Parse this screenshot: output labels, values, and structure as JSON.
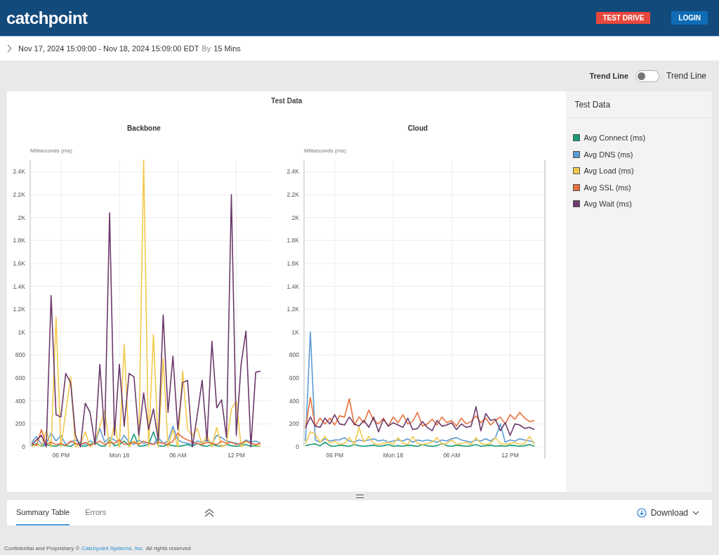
{
  "header": {
    "logo": "catchpoint",
    "buttons": [
      {
        "label": "TEST DRIVE",
        "kind": "trial"
      },
      {
        "label": "LOGIN",
        "kind": "login"
      }
    ]
  },
  "date_range": {
    "range": "Nov 17, 2024 15:09:00 - Nov 18, 2024 15:09:00 EDT",
    "by": "By",
    "interval": "15 Mins"
  },
  "trend_line": {
    "label": "Trend Line",
    "toggle_label": "Trend Line",
    "on": false
  },
  "panel": {
    "title": "Test Data",
    "charts": [
      {
        "chart_data": {
          "type": "line",
          "title": "Backbone",
          "ylabel": "Miliseconds (ms)",
          "categories": [
            null,
            null,
            null,
            null,
            null,
            null,
            "06 PM",
            null,
            null,
            null,
            null,
            null,
            null,
            null,
            null,
            null,
            null,
            null,
            "Mon 18",
            null,
            null,
            null,
            null,
            null,
            null,
            null,
            null,
            null,
            null,
            null,
            "06 AM",
            null,
            null,
            null,
            null,
            null,
            null,
            null,
            null,
            null,
            null,
            null,
            "12 PM",
            null,
            null,
            null,
            null,
            null
          ],
          "ylim": [
            0,
            2500
          ],
          "yticks": [
            0,
            200,
            400,
            600,
            800,
            {
              "value": 1000,
              "label": "1K"
            },
            {
              "value": 1200,
              "label": "1.2K"
            },
            {
              "value": 1400,
              "label": "1.4K"
            },
            {
              "value": 1600,
              "label": "1.6K"
            },
            {
              "value": 1800,
              "label": "1.8K"
            },
            {
              "value": 2000,
              "label": "2K"
            },
            {
              "value": 2200,
              "label": "2.2K"
            },
            {
              "value": 2400,
              "label": "2.4K"
            }
          ],
          "grid": true,
          "series": [
            {
              "color": "#1a9a78",
              "values": [
                10,
                30,
                5,
                20,
                10,
                5,
                20,
                10,
                5,
                30,
                10,
                5,
                20,
                40,
                10,
                5,
                60,
                10,
                20,
                50,
                10,
                110,
                5,
                10,
                20,
                130,
                10,
                5,
                20,
                10,
                5,
                10,
                20,
                5,
                30,
                10,
                5,
                20,
                10,
                5,
                20,
                10,
                5,
                10,
                20,
                5,
                10,
                5
              ]
            },
            {
              "color": "#5b9bd5",
              "values": [
                40,
                90,
                20,
                30,
                120,
                50,
                100,
                20,
                40,
                60,
                30,
                20,
                50,
                30,
                160,
                40,
                80,
                60,
                30,
                100,
                40,
                20,
                60,
                30,
                40,
                20,
                80,
                30,
                50,
                180,
                60,
                40,
                30,
                20,
                50,
                40,
                60,
                30,
                100,
                80,
                50,
                40,
                30,
                20,
                60,
                40,
                50,
                30
              ]
            },
            {
              "color": "#f2c94c",
              "values": [
                0,
                20,
                10,
                140,
                0,
                1130,
                0,
                300,
                610,
                0,
                20,
                130,
                0,
                50,
                180,
                310,
                0,
                200,
                0,
                890,
                0,
                50,
                20,
                2500,
                0,
                980,
                0,
                770,
                0,
                150,
                0,
                660,
                150,
                100,
                160,
                20,
                100,
                0,
                170,
                0,
                20,
                330,
                400,
                0,
                50,
                30,
                20,
                0
              ]
            },
            {
              "color": "#e8703a",
              "values": [
                30,
                10,
                150,
                20,
                40,
                20,
                30,
                10,
                50,
                30,
                20,
                40,
                10,
                30,
                50,
                20,
                40,
                30,
                60,
                20,
                30,
                40,
                20,
                50,
                30,
                20,
                40,
                30,
                20,
                50,
                120,
                80,
                60,
                40,
                30,
                20,
                40,
                30,
                20,
                50,
                30,
                40,
                20,
                30,
                50,
                30,
                20,
                30
              ]
            },
            {
              "color": "#6b3a6b",
              "values": [
                20,
                60,
                100,
                0,
                1320,
                280,
                260,
                640,
                560,
                100,
                0,
                380,
                300,
                20,
                720,
                100,
                2040,
                100,
                720,
                180,
                640,
                610,
                100,
                470,
                150,
                330,
                50,
                1150,
                300,
                790,
                150,
                560,
                580,
                0,
                280,
                580,
                50,
                920,
                340,
                410,
                80,
                2200,
                100,
                720,
                1010,
                0,
                650,
                660
              ]
            }
          ]
        }
      },
      {
        "chart_data": {
          "type": "line",
          "title": "Cloud",
          "ylabel": "Miliseconds (ms)",
          "categories": [
            null,
            null,
            null,
            null,
            null,
            null,
            "06 PM",
            null,
            null,
            null,
            null,
            null,
            null,
            null,
            null,
            null,
            null,
            null,
            "Mon 18",
            null,
            null,
            null,
            null,
            null,
            null,
            null,
            null,
            null,
            null,
            null,
            "06 AM",
            null,
            null,
            null,
            null,
            null,
            null,
            null,
            null,
            null,
            null,
            null,
            "12 PM",
            null,
            null,
            null,
            null,
            null
          ],
          "ylim": [
            0,
            2500
          ],
          "yticks": [
            0,
            200,
            400,
            600,
            800,
            {
              "value": 1000,
              "label": "1K"
            },
            {
              "value": 1200,
              "label": "1.2K"
            },
            {
              "value": 1400,
              "label": "1.4K"
            },
            {
              "value": 1600,
              "label": "1.6K"
            },
            {
              "value": 1800,
              "label": "1.8K"
            },
            {
              "value": 2000,
              "label": "2K"
            },
            {
              "value": 2200,
              "label": "2.2K"
            },
            {
              "value": 2400,
              "label": "2.4K"
            }
          ],
          "grid": true,
          "series": [
            {
              "color": "#1a9a78",
              "values": [
                10,
                20,
                25,
                10,
                40,
                10,
                5,
                15,
                10,
                5,
                20,
                10,
                5,
                10,
                15,
                5,
                10,
                20,
                5,
                10,
                5,
                15,
                10,
                5,
                20,
                10,
                5,
                10,
                30,
                10,
                5,
                15,
                10,
                5,
                10,
                20,
                5,
                10,
                15,
                5,
                10,
                5,
                15,
                10,
                5,
                10,
                20,
                5
              ]
            },
            {
              "color": "#5b9bd5",
              "values": [
                50,
                1000,
                60,
                40,
                70,
                50,
                60,
                60,
                80,
                50,
                40,
                60,
                50,
                60,
                70,
                50,
                60,
                40,
                50,
                60,
                50,
                70,
                40,
                60,
                50,
                60,
                50,
                40,
                60,
                50,
                70,
                80,
                60,
                50,
                40,
                60,
                50,
                70,
                50,
                80,
                200,
                40,
                60,
                50,
                70,
                60,
                50,
                40
              ]
            },
            {
              "color": "#f2c94c",
              "values": [
                30,
                130,
                110,
                40,
                90,
                30,
                50,
                20,
                30,
                80,
                20,
                170,
                40,
                90,
                30,
                20,
                30,
                40,
                20,
                80,
                30,
                20,
                90,
                30,
                20,
                30,
                40,
                80,
                20,
                30,
                60,
                20,
                30,
                40,
                20,
                80,
                30,
                20,
                30,
                80,
                30,
                20,
                30,
                40,
                20,
                30,
                90,
                20
              ]
            },
            {
              "color": "#e8703a",
              "values": [
                160,
                430,
                180,
                250,
                200,
                250,
                190,
                270,
                260,
                420,
                190,
                260,
                210,
                320,
                230,
                200,
                250,
                180,
                260,
                210,
                280,
                200,
                220,
                300,
                180,
                200,
                240,
                190,
                260,
                210,
                230,
                180,
                250,
                200,
                220,
                270,
                210,
                250,
                190,
                230,
                260,
                200,
                280,
                240,
                300,
                250,
                220,
                230
              ]
            },
            {
              "color": "#6b3a6b",
              "values": [
                170,
                260,
                180,
                170,
                250,
                200,
                280,
                200,
                190,
                260,
                200,
                180,
                230,
                170,
                260,
                130,
                240,
                180,
                210,
                190,
                170,
                250,
                150,
                160,
                220,
                170,
                140,
                230,
                180,
                190,
                210,
                150,
                200,
                170,
                180,
                350,
                140,
                290,
                230,
                240,
                140,
                210,
                100,
                200,
                190,
                160,
                170,
                150
              ]
            }
          ]
        }
      }
    ]
  },
  "legend": {
    "title": "Test Data",
    "items": [
      {
        "label": "Avg Connect (ms)",
        "color": "#1a9a78"
      },
      {
        "label": "Avg DNS (ms)",
        "color": "#5b9bd5"
      },
      {
        "label": "Avg Load (ms)",
        "color": "#f2c94c"
      },
      {
        "label": "Avg SSL (ms)",
        "color": "#e8703a"
      },
      {
        "label": "Avg Wait (ms)",
        "color": "#6b3a6b"
      }
    ]
  },
  "bottom_tabs": [
    {
      "label": "Summary Table",
      "selected": true
    },
    {
      "label": "Errors",
      "selected": false
    }
  ],
  "download": {
    "label": "Download"
  },
  "footer": {
    "text_before": "Confidential and Proprietary ©",
    "link": "Catchpoint Systems, Inc.",
    "text_after": "All rights reserved"
  }
}
